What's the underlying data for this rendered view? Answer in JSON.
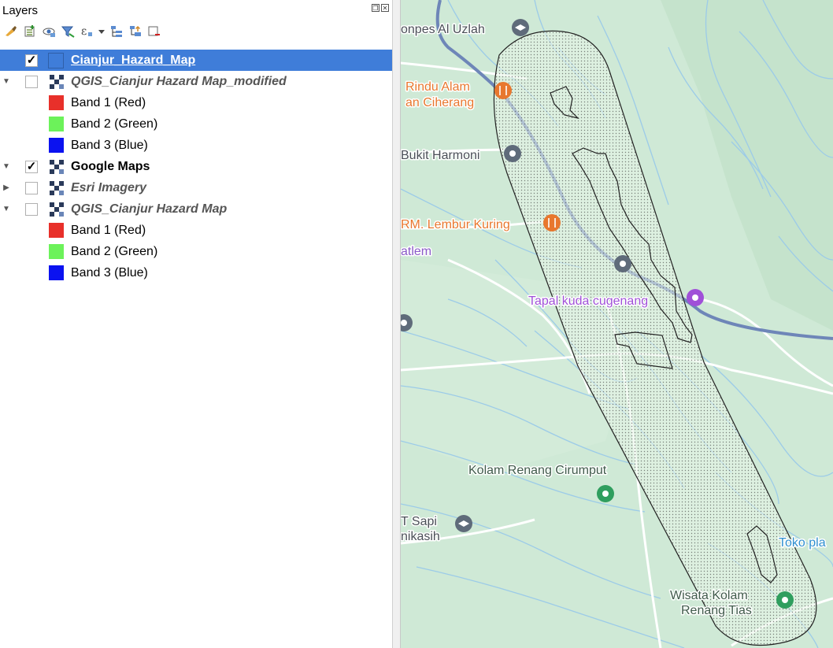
{
  "panel": {
    "title": "Layers",
    "title_buttons": [
      "float",
      "close"
    ]
  },
  "toolbar": [
    "style-icon",
    "add-group-icon",
    "manage-visibility-icon",
    "filter-icon",
    "filter-expression-icon",
    "dropdown-arrow-icon",
    "expand-all-icon",
    "collapse-all-icon",
    "remove-layer-icon"
  ],
  "layers": [
    {
      "label": "Cianjur_Hazard_Map",
      "checked": true,
      "selected": true
    },
    {
      "label": "QGIS_Cianjur Hazard Map_modified",
      "checked": false,
      "expanded": true
    },
    {
      "label": "Band 1 (Red)",
      "color": "#e8302a"
    },
    {
      "label": "Band 2 (Green)",
      "color": "#6cf25a"
    },
    {
      "label": "Band 3 (Blue)",
      "color": "#0b12f0"
    },
    {
      "label": "Google Maps",
      "checked": true,
      "expanded": true
    },
    {
      "label": "Esri Imagery",
      "checked": false,
      "expanded": false
    },
    {
      "label": "QGIS_Cianjur Hazard Map",
      "checked": false,
      "expanded": true
    },
    {
      "label": "Band 1 (Red)",
      "color": "#e8302a"
    },
    {
      "label": "Band 2 (Green)",
      "color": "#6cf25a"
    },
    {
      "label": "Band 3 (Blue)",
      "color": "#0b12f0"
    }
  ],
  "map": {
    "labels": {
      "pesantren": "onpes Al Uzlah",
      "rindu_line1": "Rindu Alam",
      "rindu_line2": "an Ciherang",
      "harmoni": "Bukit Harmoni",
      "lembur": "RM. Lembur Kuring",
      "atlem": "atlem",
      "tapal": "Tapal kuda cugenang",
      "kolam": "Kolam Renang Cirumput",
      "sapi_line1": "T Sapi",
      "sapi_line2": "nikasih",
      "toko": "Toko pla",
      "wisata_line1": "Wisata Kolam",
      "wisata_line2": "Renang Tias"
    },
    "colors": {
      "base": "#cfe9d6",
      "river": "#9ccbe8",
      "main_road": "#6e86b8",
      "poi_orange": "#e8772e",
      "poi_gray": "#5f6b7a",
      "poi_purple": "#a050d8",
      "poi_green": "#2f9e5e"
    }
  }
}
